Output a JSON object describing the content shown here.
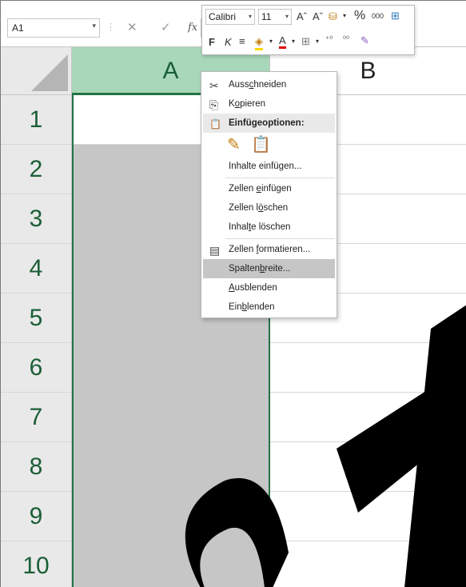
{
  "formula_bar": {
    "name_box": "A1",
    "name_box_arrow": "▾",
    "separator": "⋮",
    "cancel_glyph": "✕",
    "enter_glyph": "✓",
    "fx_label": "fx"
  },
  "mini_toolbar": {
    "font_name": "Calibri",
    "font_size": "11",
    "dropdown_arrow": "▾",
    "row1_glyphs": [
      "Aˆ",
      "Aˇ",
      "⛁",
      "▾",
      "%",
      "000",
      "⊞"
    ],
    "bold_label": "F",
    "italic_label": "K",
    "row2_glyphs": [
      "≡",
      "◈",
      "▾",
      "A",
      "▾",
      "⊞",
      "▾",
      "⁺⁰",
      "⁰⁰",
      "✎"
    ]
  },
  "sheet": {
    "columns": [
      "A",
      "B"
    ],
    "rows": [
      "1",
      "2",
      "3",
      "4",
      "5",
      "6",
      "7",
      "8",
      "9",
      "10"
    ]
  },
  "context_menu": {
    "items": [
      {
        "before": "Auss",
        "mnemonic": "c",
        "after": "hneiden",
        "icon": "cut-icon",
        "glyph": "✂"
      },
      {
        "before": "K",
        "mnemonic": "o",
        "after": "pieren",
        "icon": "copy-icon",
        "glyph": "⎘"
      },
      {
        "before": "",
        "mnemonic": "",
        "after": "Einfügeoptionen:",
        "icon": "clipboard-icon",
        "glyph": "📋"
      },
      {
        "before": "Inhalte einfü",
        "mnemonic": "g",
        "after": "en...",
        "icon": "",
        "glyph": ""
      },
      {
        "before": "Zellen ",
        "mnemonic": "e",
        "after": "infügen",
        "icon": "",
        "glyph": ""
      },
      {
        "before": "Zellen l",
        "mnemonic": "ö",
        "after": "schen",
        "icon": "",
        "glyph": ""
      },
      {
        "before": "Inhal",
        "mnemonic": "t",
        "after": "e löschen",
        "icon": "",
        "glyph": ""
      },
      {
        "before": "Zellen ",
        "mnemonic": "f",
        "after": "ormatieren...",
        "icon": "format-cells-icon",
        "glyph": "▤"
      },
      {
        "before": "Spalten",
        "mnemonic": "b",
        "after": "reite...",
        "icon": "",
        "glyph": ""
      },
      {
        "before": "",
        "mnemonic": "A",
        "after": "usblenden",
        "icon": "",
        "glyph": ""
      },
      {
        "before": "Ein",
        "mnemonic": "b",
        "after": "lenden",
        "icon": "",
        "glyph": ""
      }
    ],
    "paste_glyphs": [
      "✎",
      "📋"
    ]
  },
  "colors": {
    "accent": "#217346",
    "header_selected": "#a8d8b9",
    "selection": "#c6c6c6"
  }
}
